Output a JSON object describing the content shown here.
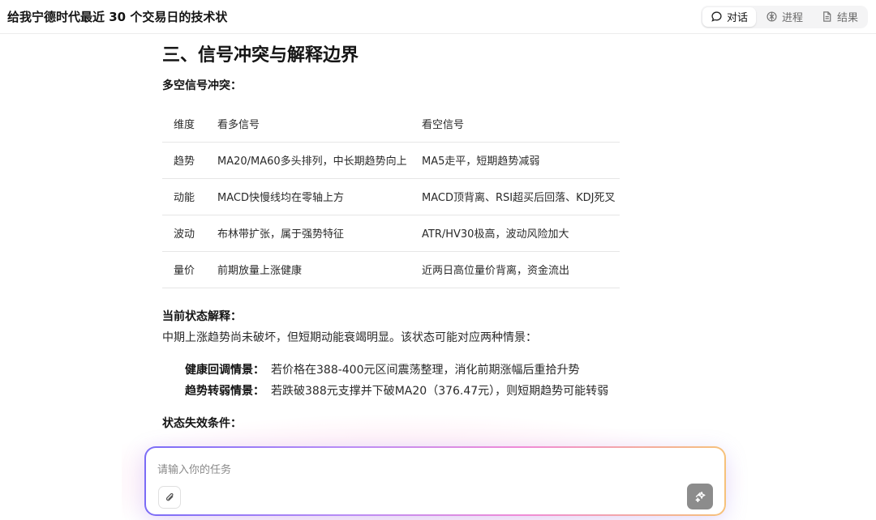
{
  "header": {
    "title": "给我宁德时代最近 30 个交易日的技术状",
    "tabs": [
      {
        "label": "对话",
        "icon": "chat-bubble-icon",
        "active": true
      },
      {
        "label": "进程",
        "icon": "process-icon",
        "active": false
      },
      {
        "label": "结果",
        "icon": "document-icon",
        "active": false
      }
    ]
  },
  "content": {
    "section_heading": "三、信号冲突与解释边界",
    "conflict_heading": "多空信号冲突：",
    "table": {
      "headers": [
        "维度",
        "看多信号",
        "看空信号"
      ],
      "rows": [
        [
          "趋势",
          "MA20/MA60多头排列，中长期趋势向上",
          "MA5走平，短期趋势减弱"
        ],
        [
          "动能",
          "MACD快慢线均在零轴上方",
          "MACD顶背离、RSI超买后回落、KDJ死叉"
        ],
        [
          "波动",
          "布林带扩张，属于强势特征",
          "ATR/HV30极高，波动风险加大"
        ],
        [
          "量价",
          "前期放量上涨健康",
          "近两日高位量价背离，资金流出"
        ]
      ]
    },
    "state_heading": "当前状态解释：",
    "state_text": "中期上涨趋势尚未破坏，但短期动能衰竭明显。该状态可能对应两种情景：",
    "scenarios": [
      {
        "label": "健康回调情景：",
        "text": "若价格在388-400元区间震荡整理，消化前期涨幅后重拾升势"
      },
      {
        "label": "趋势转弱情景：",
        "text": "若跌破388元支撑并下破MA20（376.47元），则短期趋势可能转弱"
      }
    ],
    "invalid_heading": "状态失效条件："
  },
  "composer": {
    "placeholder": "请输入你的任务",
    "value": ""
  },
  "colors": {
    "gradient_start": "#7b6cf6",
    "gradient_mid": "#f08bd6",
    "gradient_end": "#f6c27a",
    "send_button": "#8c8c8c"
  }
}
